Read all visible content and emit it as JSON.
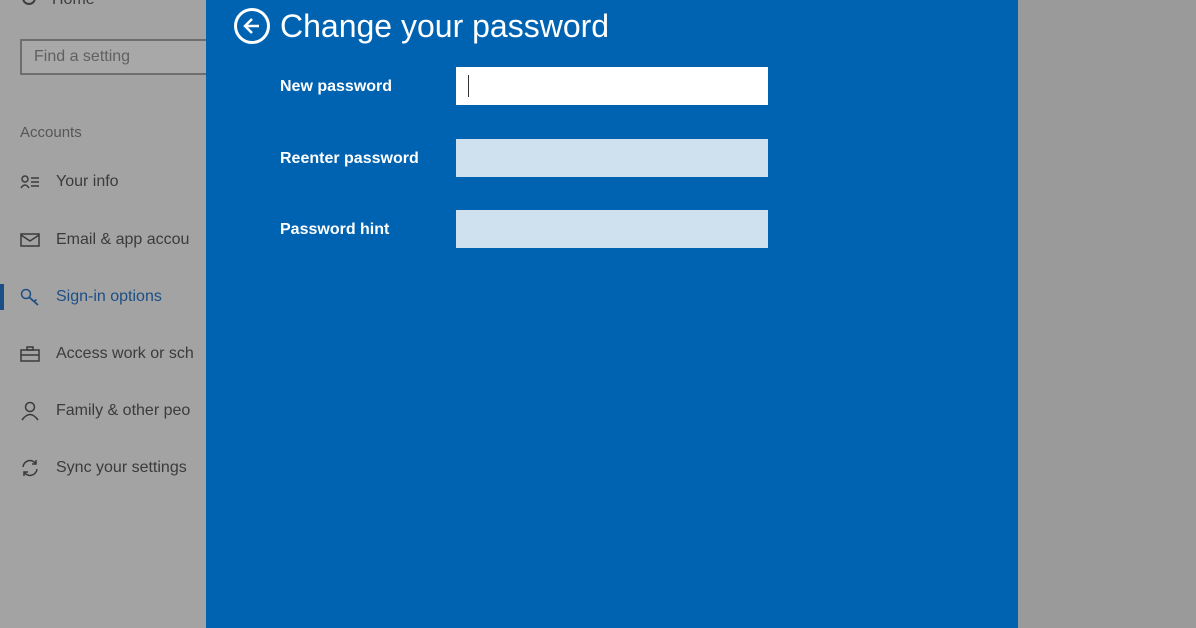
{
  "sidebar": {
    "home_label": "Home",
    "search_placeholder": "Find a setting",
    "section_heading": "Accounts",
    "items": [
      {
        "label": "Your info",
        "icon": "person-card-icon"
      },
      {
        "label": "Email & app accou",
        "icon": "mail-icon"
      },
      {
        "label": "Sign-in options",
        "icon": "key-icon",
        "active": true
      },
      {
        "label": "Access work or sch",
        "icon": "briefcase-icon"
      },
      {
        "label": "Family & other peo",
        "icon": "person-icon"
      },
      {
        "label": "Sync your settings",
        "icon": "sync-icon"
      }
    ]
  },
  "dialog": {
    "title": "Change your password",
    "fields": [
      {
        "label": "New password",
        "value": "",
        "state": "focused"
      },
      {
        "label": "Reenter password",
        "value": "",
        "state": "inactive"
      },
      {
        "label": "Password hint",
        "value": "",
        "state": "inactive"
      }
    ]
  },
  "colors": {
    "dialog_bg": "#0063b1",
    "accent": "#1c4f86",
    "overlay_gray": "#9e9e9e"
  }
}
